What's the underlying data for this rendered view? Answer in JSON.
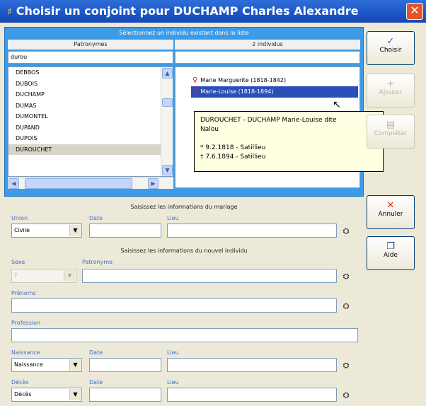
{
  "window": {
    "title": "Choisir un conjoint pour DUCHAMP Charles Alexandre",
    "close_label": "✕",
    "app_icon": "♯"
  },
  "selection": {
    "header": "Sélectionnez un individu existant dans la liste",
    "patronymes_label": "Patronymes",
    "individus_label": "2 individus",
    "filter_value": "durou",
    "patronymes": [
      "DEBBOS",
      "DUBOIS",
      "DUCHAMP",
      "DUMAS",
      "DUMONTEL",
      "DUPAND",
      "DUPOIS",
      "DUROUCHET"
    ],
    "selected_patronyme_index": 7,
    "individus": [
      {
        "name": "Marie Marguerite (1818-1842)",
        "icon": "female-icon"
      },
      {
        "name": "Marie-Louise (1818-1894)",
        "icon": "female-icon",
        "selected": true
      }
    ],
    "tooltip": {
      "line1": "DUROUCHET  -  DUCHAMP Marie-Louise dite",
      "line2": "Nalou",
      "line3": "* 9.2.1818 - Satillieu",
      "line4": "† 7.6.1894 - Satillieu"
    }
  },
  "mariage": {
    "header": "Saisissez les informations du mariage",
    "union_label": "Union",
    "union_value": "Civile",
    "date_label": "Date",
    "lieu_label": "Lieu"
  },
  "nouvel": {
    "header": "Saisissez les informations du nouvel individu",
    "sexe_label": "Sexe",
    "sexe_value": "?",
    "patronyme_label": "Patronyme",
    "prenoms_label": "Prénoms",
    "profession_label": "Profession",
    "naissance_label": "Naissance",
    "naissance_value": "Naissance",
    "naissance_date_label": "Date",
    "naissance_lieu_label": "Lieu",
    "deces_label": "Décès",
    "deces_value": "Décès",
    "deces_date_label": "Date",
    "deces_lieu_label": "Lieu"
  },
  "buttons": {
    "choisir": "Choisir",
    "ajouter": "Ajouter",
    "completer": "Compléter",
    "annuler": "Annuler",
    "aide": "Aide"
  },
  "colors": {
    "title_blue": "#1c55c6",
    "frame_blue": "#3c9be6",
    "label_blue": "#3c6fd1",
    "tooltip_bg": "#ffffe1"
  }
}
